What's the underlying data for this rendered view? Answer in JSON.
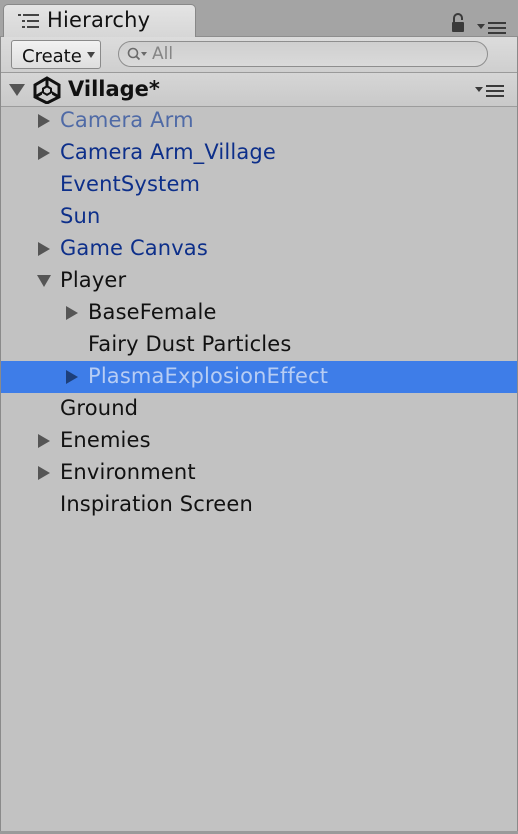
{
  "window": {
    "tab_title": "Hierarchy"
  },
  "toolbar": {
    "create_label": "Create",
    "search_value": "",
    "search_placeholder": "All"
  },
  "scene": {
    "name": "Village*",
    "expanded": true
  },
  "colors": {
    "panel_bg": "#c2c2c2",
    "selection_bg": "#3e7de8",
    "prefab_text": "#0d2f8a",
    "prefab_inactive_text": "#4f6aa6",
    "normal_text": "#111111",
    "selected_text": "#b7cdf4"
  },
  "icons": {
    "tab": "hierarchy-list-icon",
    "lock": "lock-icon",
    "menu": "context-menu-icon",
    "scene": "unity-logo-icon",
    "search": "search-icon"
  },
  "tree": {
    "items": [
      {
        "label": "Camera Arm",
        "depth": 0,
        "has_children": true,
        "expanded": false,
        "kind": "prefab-inactive",
        "selected": false
      },
      {
        "label": "Camera Arm_Village",
        "depth": 0,
        "has_children": true,
        "expanded": false,
        "kind": "prefab",
        "selected": false
      },
      {
        "label": "EventSystem",
        "depth": 0,
        "has_children": false,
        "expanded": false,
        "kind": "prefab",
        "selected": false
      },
      {
        "label": "Sun",
        "depth": 0,
        "has_children": false,
        "expanded": false,
        "kind": "prefab",
        "selected": false
      },
      {
        "label": "Game Canvas",
        "depth": 0,
        "has_children": true,
        "expanded": false,
        "kind": "prefab",
        "selected": false
      },
      {
        "label": "Player",
        "depth": 0,
        "has_children": true,
        "expanded": true,
        "kind": "normal",
        "selected": false
      },
      {
        "label": "BaseFemale",
        "depth": 1,
        "has_children": true,
        "expanded": false,
        "kind": "normal",
        "selected": false
      },
      {
        "label": "Fairy Dust Particles",
        "depth": 1,
        "has_children": false,
        "expanded": false,
        "kind": "normal",
        "selected": false
      },
      {
        "label": "PlasmaExplosionEffect",
        "depth": 1,
        "has_children": true,
        "expanded": false,
        "kind": "normal",
        "selected": true
      },
      {
        "label": "Ground",
        "depth": 0,
        "has_children": false,
        "expanded": false,
        "kind": "normal",
        "selected": false
      },
      {
        "label": "Enemies",
        "depth": 0,
        "has_children": true,
        "expanded": false,
        "kind": "normal",
        "selected": false
      },
      {
        "label": "Environment",
        "depth": 0,
        "has_children": true,
        "expanded": false,
        "kind": "normal",
        "selected": false
      },
      {
        "label": "Inspiration Screen",
        "depth": 0,
        "has_children": false,
        "expanded": false,
        "kind": "normal",
        "selected": false
      }
    ]
  }
}
